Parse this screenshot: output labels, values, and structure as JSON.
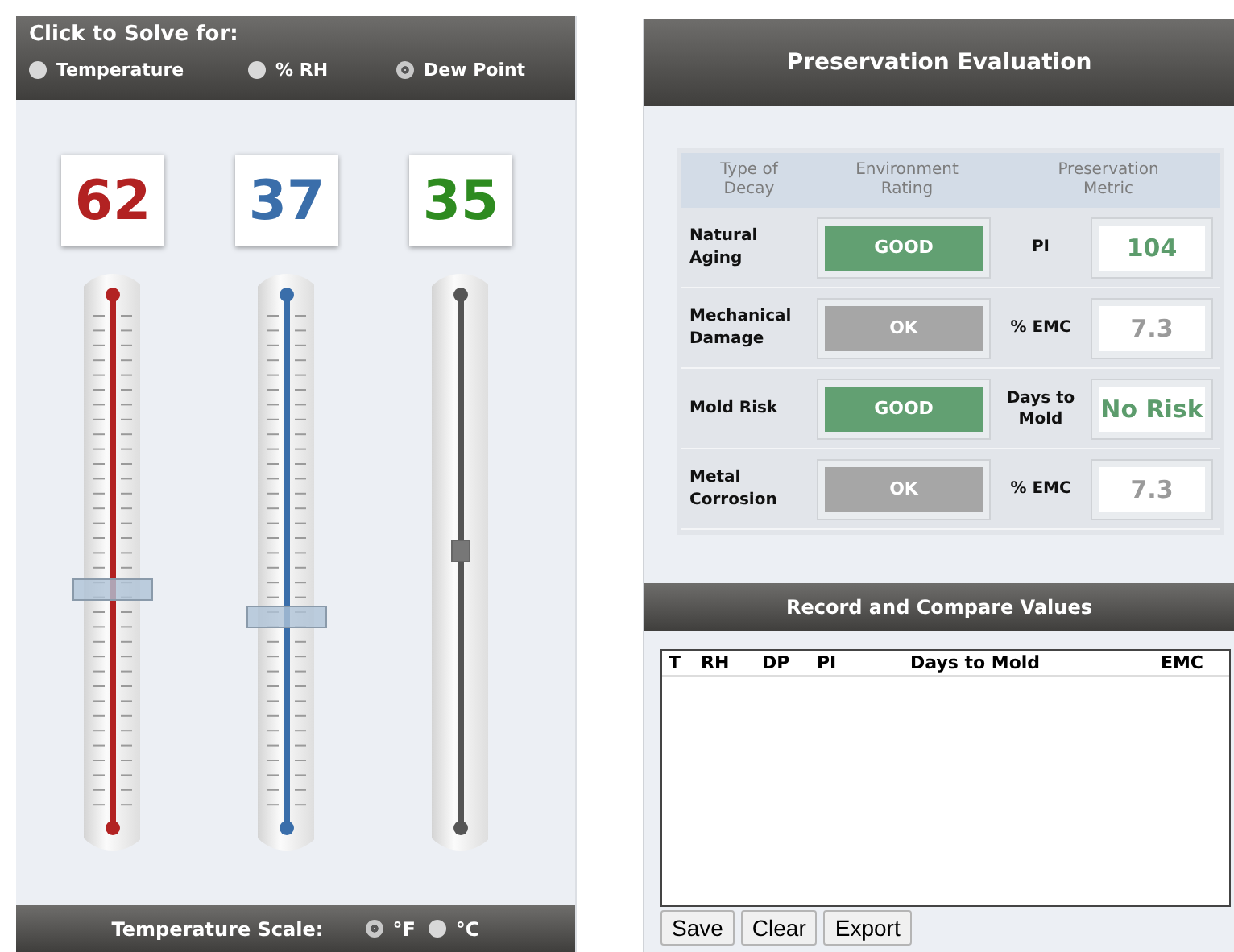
{
  "solve_panel": {
    "title": "Click to Solve for:",
    "options": [
      {
        "label": "Temperature",
        "selected": false
      },
      {
        "label": "% RH",
        "selected": false
      },
      {
        "label": "Dew Point",
        "selected": true
      }
    ]
  },
  "sliders": [
    {
      "value": "62",
      "color": "#b22222",
      "level": 0.45,
      "kind": "input"
    },
    {
      "value": "37",
      "color": "#3a6eaa",
      "level": 0.4,
      "kind": "input"
    },
    {
      "value": "35",
      "color": "#2e8b20",
      "level": 0.52,
      "kind": "computed"
    }
  ],
  "scale": {
    "label": "Temperature Scale:",
    "options": [
      {
        "label": "°F",
        "selected": true
      },
      {
        "label": "°C",
        "selected": false
      }
    ]
  },
  "evaluation": {
    "title": "Preservation Evaluation",
    "columns": [
      "Type of Decay",
      "Environment Rating",
      "Preservation Metric"
    ],
    "rows": [
      {
        "type": "Natural Aging",
        "rating": "GOOD",
        "kind": "good",
        "metric": "PI",
        "value": "104"
      },
      {
        "type": "Mechanical Damage",
        "rating": "OK",
        "kind": "ok",
        "metric": "% EMC",
        "value": "7.3"
      },
      {
        "type": "Mold Risk",
        "rating": "GOOD",
        "kind": "good",
        "metric": "Days to Mold",
        "value": "No Risk"
      },
      {
        "type": "Metal Corrosion",
        "rating": "OK",
        "kind": "ok",
        "metric": "% EMC",
        "value": "7.3"
      }
    ]
  },
  "record": {
    "title": "Record and Compare Values",
    "columns": [
      "T",
      "RH",
      "DP",
      "PI",
      "Days to Mold",
      "EMC"
    ],
    "buttons": [
      "Save",
      "Clear",
      "Export"
    ]
  }
}
